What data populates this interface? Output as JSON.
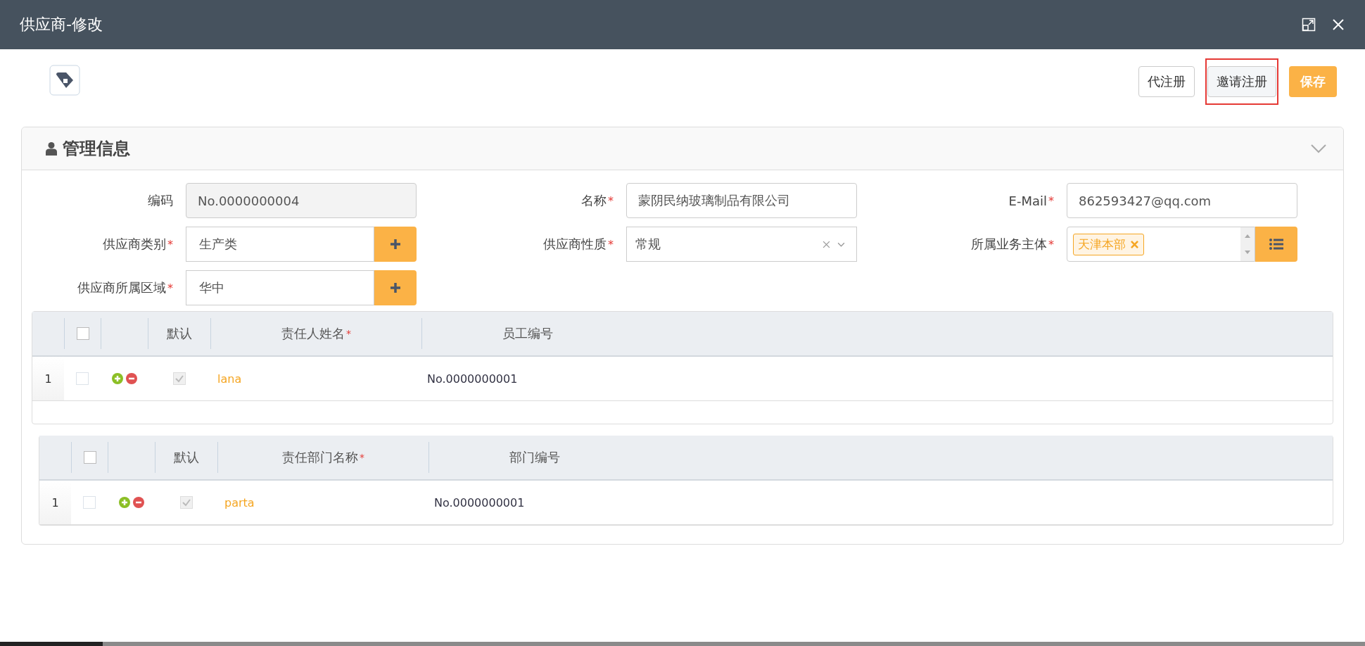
{
  "window": {
    "title": "供应商-修改"
  },
  "toolbar": {
    "buttons": [
      {
        "label": "代注册",
        "kind": "default",
        "highlighted": false
      },
      {
        "label": "邀请注册",
        "kind": "default",
        "highlighted": true
      },
      {
        "label": "保存",
        "kind": "primary",
        "highlighted": false
      }
    ]
  },
  "panel": {
    "title": "管理信息",
    "expanded": true,
    "fields": [
      {
        "label": "编码",
        "kind": "readonly",
        "value": "No.0000000004"
      },
      {
        "label": "名称",
        "required_mark": "*",
        "kind": "text",
        "value": "蒙阴民纳玻璃制品有限公司"
      },
      {
        "label": "E-Mail",
        "required_mark": "*",
        "kind": "text",
        "value": "862593427@qq.com"
      },
      {
        "label": "供应商类别",
        "required_mark": "*",
        "kind": "add",
        "value": "生产类"
      },
      {
        "label": "供应商性质",
        "required_mark": "*",
        "kind": "select",
        "value": "常规"
      },
      {
        "label": "所属业务主体",
        "required_mark": "*",
        "kind": "tags",
        "tags": [
          "天津本部"
        ]
      },
      {
        "label": "供应商所属区域",
        "required_mark": "*",
        "kind": "add",
        "value": "华中"
      }
    ],
    "tables": [
      {
        "columns": [
          {
            "label": "默认"
          },
          {
            "label": "责任人姓名",
            "required_mark": "*"
          },
          {
            "label": "员工编号"
          }
        ],
        "header_checked": false,
        "rows": [
          {
            "index": "1",
            "checked": false,
            "default": true,
            "name": "lana",
            "code": "No.0000000001"
          }
        ]
      },
      {
        "columns": [
          {
            "label": "默认"
          },
          {
            "label": "责任部门名称",
            "required_mark": "*"
          },
          {
            "label": "部门编号"
          }
        ],
        "header_checked": false,
        "rows": [
          {
            "index": "1",
            "checked": false,
            "default": true,
            "name": "parta",
            "code": "No.0000000001"
          }
        ]
      }
    ]
  }
}
